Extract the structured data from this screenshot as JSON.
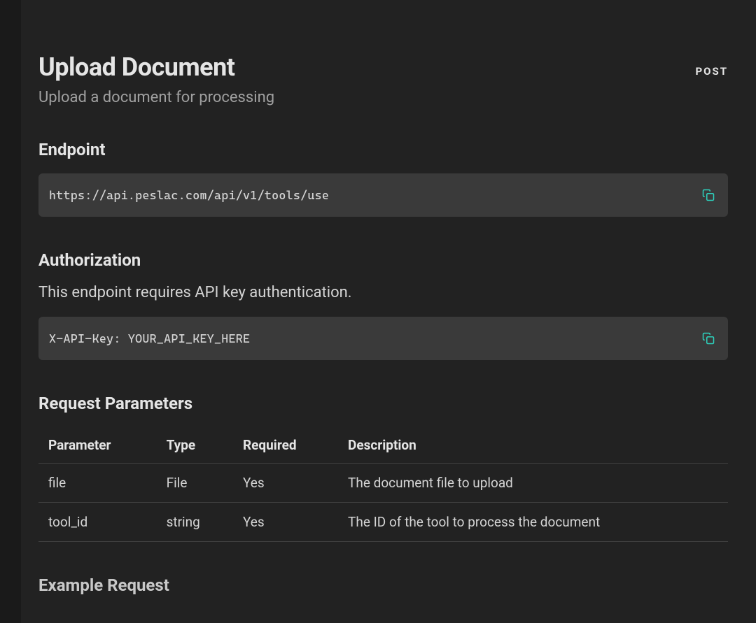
{
  "header": {
    "title": "Upload Document",
    "subtitle": "Upload a document for processing",
    "method": "POST"
  },
  "endpoint": {
    "heading": "Endpoint",
    "url": "https://api.peslac.com/api/v1/tools/use"
  },
  "authorization": {
    "heading": "Authorization",
    "description": "This endpoint requires API key authentication.",
    "code": "X-API-Key: YOUR_API_KEY_HERE"
  },
  "parameters": {
    "heading": "Request Parameters",
    "columns": {
      "param": "Parameter",
      "type": "Type",
      "required": "Required",
      "description": "Description"
    },
    "rows": [
      {
        "param": "file",
        "type": "File",
        "required": "Yes",
        "description": "The document file to upload"
      },
      {
        "param": "tool_id",
        "type": "string",
        "required": "Yes",
        "description": "The ID of the tool to process the document"
      }
    ]
  },
  "example": {
    "heading": "Example Request"
  }
}
